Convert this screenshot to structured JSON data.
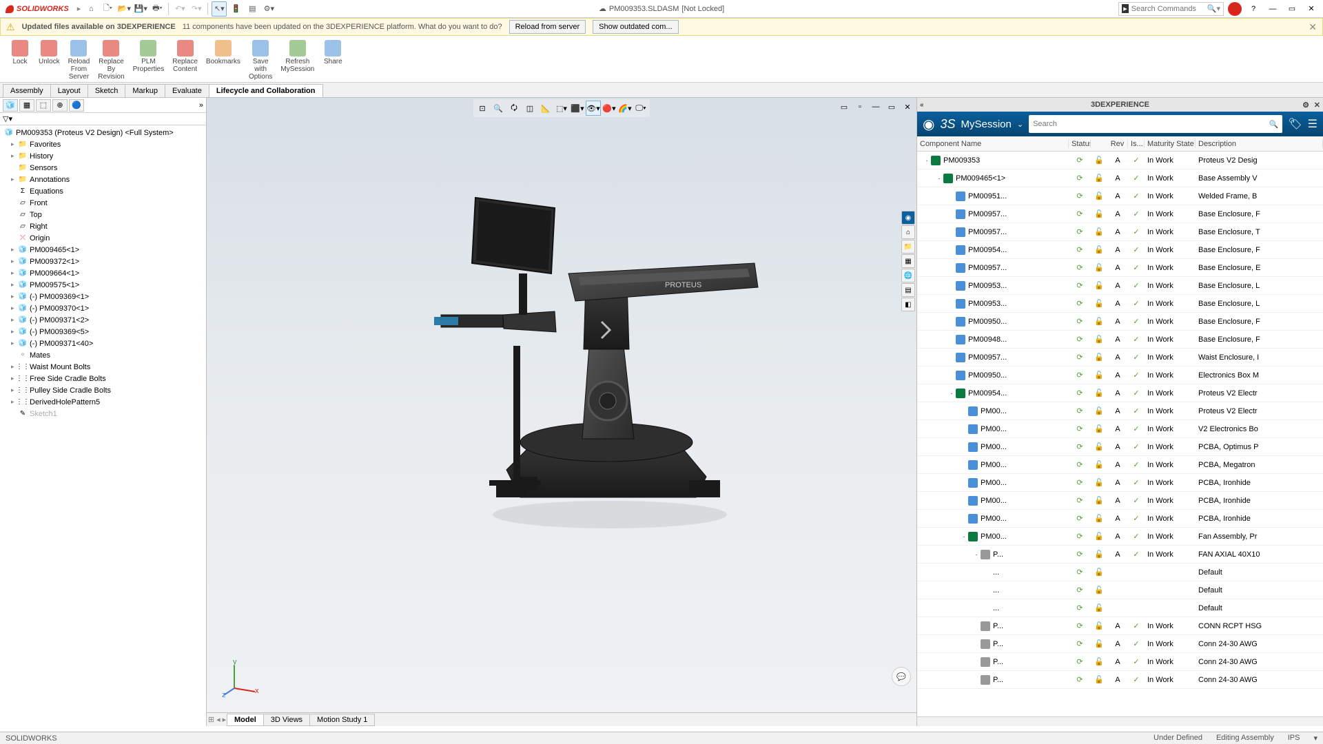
{
  "app": {
    "name": "SOLIDWORKS"
  },
  "document": {
    "filename": "PM009353.SLDASM",
    "lock_state": "[Not Locked]"
  },
  "search_commands": {
    "placeholder": "Search Commands"
  },
  "notification": {
    "bold": "Updated files available on 3DEXPERIENCE",
    "msg": "11 components have been updated on the 3DEXPERIENCE platform. What do you want to do?",
    "btn_reload": "Reload from server",
    "btn_show": "Show outdated com..."
  },
  "ribbon": [
    {
      "label": "Lock"
    },
    {
      "label": "Unlock"
    },
    {
      "label": "Reload\nFrom\nServer"
    },
    {
      "label": "Replace\nBy\nRevision"
    },
    {
      "label": "PLM\nProperties"
    },
    {
      "label": "Replace\nContent"
    },
    {
      "label": "Bookmarks"
    },
    {
      "label": "Save\nwith\nOptions"
    },
    {
      "label": "Refresh\nMySession"
    },
    {
      "label": "Share"
    }
  ],
  "tabs": [
    "Assembly",
    "Layout",
    "Sketch",
    "Markup",
    "Evaluate",
    "Lifecycle and Collaboration"
  ],
  "active_tab": 5,
  "feature_tree": {
    "root": "PM009353 (Proteus V2 Design) <Full System>",
    "nodes": [
      {
        "label": "Favorites",
        "ico": "folder",
        "arrow": true
      },
      {
        "label": "History",
        "ico": "folder",
        "arrow": true
      },
      {
        "label": "Sensors",
        "ico": "folder",
        "arrow": false
      },
      {
        "label": "Annotations",
        "ico": "folder",
        "arrow": true
      },
      {
        "label": "Equations",
        "ico": "eq",
        "arrow": false
      },
      {
        "label": "Front",
        "ico": "plane",
        "arrow": false
      },
      {
        "label": "Top",
        "ico": "plane",
        "arrow": false
      },
      {
        "label": "Right",
        "ico": "plane",
        "arrow": false
      },
      {
        "label": "Origin",
        "ico": "origin",
        "arrow": false
      },
      {
        "label": "PM009465<1>",
        "ico": "asm",
        "arrow": true
      },
      {
        "label": "PM009372<1>",
        "ico": "asm",
        "arrow": true
      },
      {
        "label": "PM009664<1>",
        "ico": "asm",
        "arrow": true
      },
      {
        "label": "PM009575<1>",
        "ico": "asm",
        "arrow": true
      },
      {
        "label": "(-) PM009369<1>",
        "ico": "asm",
        "arrow": true
      },
      {
        "label": "(-) PM009370<1>",
        "ico": "asm",
        "arrow": true
      },
      {
        "label": "(-) PM009371<2>",
        "ico": "asm",
        "arrow": true
      },
      {
        "label": "(-) PM009369<5>",
        "ico": "asm",
        "arrow": true
      },
      {
        "label": "(-) PM009371<40>",
        "ico": "asm",
        "arrow": true
      },
      {
        "label": "Mates",
        "ico": "mate",
        "arrow": false
      },
      {
        "label": "Waist Mount Bolts",
        "ico": "pattern",
        "arrow": true
      },
      {
        "label": "Free Side Cradle Bolts",
        "ico": "pattern",
        "arrow": true
      },
      {
        "label": "Pulley Side Cradle Bolts",
        "ico": "pattern",
        "arrow": true
      },
      {
        "label": "DerivedHolePattern5",
        "ico": "pattern",
        "arrow": true
      },
      {
        "label": "Sketch1",
        "ico": "sketch",
        "arrow": false,
        "gray": true
      }
    ]
  },
  "bottom_tabs": [
    "Model",
    "3D Views",
    "Motion Study 1"
  ],
  "active_bottom_tab": 0,
  "threedx": {
    "title": "3DEXPERIENCE",
    "session": "MySession",
    "search_placeholder": "Search",
    "columns": [
      "Component Name",
      "Status",
      "",
      "Rev",
      "Is...",
      "Maturity State",
      "Description"
    ],
    "rows": [
      {
        "indent": 0,
        "exp": "-",
        "ico": "asm",
        "name": "PM009353",
        "rev": "A",
        "mat": "In Work",
        "desc": "Proteus V2 Desig"
      },
      {
        "indent": 1,
        "exp": "-",
        "ico": "asm",
        "name": "PM009465<1>",
        "rev": "A",
        "mat": "In Work",
        "desc": "Base Assembly V"
      },
      {
        "indent": 2,
        "exp": "",
        "ico": "part",
        "name": "PM00951...",
        "rev": "A",
        "mat": "In Work",
        "desc": "Welded Frame, B"
      },
      {
        "indent": 2,
        "exp": "",
        "ico": "part",
        "name": "PM00957...",
        "rev": "A",
        "mat": "In Work",
        "desc": "Base Enclosure, F"
      },
      {
        "indent": 2,
        "exp": "",
        "ico": "part",
        "name": "PM00957...",
        "rev": "A",
        "mat": "In Work",
        "desc": "Base Enclosure, T"
      },
      {
        "indent": 2,
        "exp": "",
        "ico": "part",
        "name": "PM00954...",
        "rev": "A",
        "mat": "In Work",
        "desc": "Base Enclosure, F"
      },
      {
        "indent": 2,
        "exp": "",
        "ico": "part",
        "name": "PM00957...",
        "rev": "A",
        "mat": "In Work",
        "desc": "Base Enclosure, E"
      },
      {
        "indent": 2,
        "exp": "",
        "ico": "part",
        "name": "PM00953...",
        "rev": "A",
        "mat": "In Work",
        "desc": "Base Enclosure, L"
      },
      {
        "indent": 2,
        "exp": "",
        "ico": "part",
        "name": "PM00953...",
        "rev": "A",
        "mat": "In Work",
        "desc": "Base Enclosure, L"
      },
      {
        "indent": 2,
        "exp": "",
        "ico": "part",
        "name": "PM00950...",
        "rev": "A",
        "mat": "In Work",
        "desc": "Base Enclosure, F"
      },
      {
        "indent": 2,
        "exp": "",
        "ico": "part",
        "name": "PM00948...",
        "rev": "A",
        "mat": "In Work",
        "desc": "Base Enclosure, F"
      },
      {
        "indent": 2,
        "exp": "",
        "ico": "part",
        "name": "PM00957...",
        "rev": "A",
        "mat": "In Work",
        "desc": "Waist Enclosure, I"
      },
      {
        "indent": 2,
        "exp": "",
        "ico": "part",
        "name": "PM00950...",
        "rev": "A",
        "mat": "In Work",
        "desc": "Electronics Box M"
      },
      {
        "indent": 2,
        "exp": "-",
        "ico": "asm",
        "name": "PM00954...",
        "rev": "A",
        "mat": "In Work",
        "desc": "Proteus V2 Electr"
      },
      {
        "indent": 3,
        "exp": "",
        "ico": "part",
        "name": "PM00...",
        "rev": "A",
        "mat": "In Work",
        "desc": "Proteus V2 Electr"
      },
      {
        "indent": 3,
        "exp": "",
        "ico": "part",
        "name": "PM00...",
        "rev": "A",
        "mat": "In Work",
        "desc": "V2 Electronics Bo"
      },
      {
        "indent": 3,
        "exp": "",
        "ico": "part",
        "name": "PM00...",
        "rev": "A",
        "mat": "In Work",
        "desc": "PCBA, Optimus P"
      },
      {
        "indent": 3,
        "exp": "",
        "ico": "part",
        "name": "PM00...",
        "rev": "A",
        "mat": "In Work",
        "desc": "PCBA, Megatron"
      },
      {
        "indent": 3,
        "exp": "",
        "ico": "part",
        "name": "PM00...",
        "rev": "A",
        "mat": "In Work",
        "desc": "PCBA, Ironhide"
      },
      {
        "indent": 3,
        "exp": "",
        "ico": "part",
        "name": "PM00...",
        "rev": "A",
        "mat": "In Work",
        "desc": "PCBA, Ironhide"
      },
      {
        "indent": 3,
        "exp": "",
        "ico": "part",
        "name": "PM00...",
        "rev": "A",
        "mat": "In Work",
        "desc": "PCBA, Ironhide"
      },
      {
        "indent": 3,
        "exp": "-",
        "ico": "asm",
        "name": "PM00...",
        "rev": "A",
        "mat": "In Work",
        "desc": "Fan Assembly, Pr"
      },
      {
        "indent": 4,
        "exp": "-",
        "ico": "gray",
        "name": "P...",
        "rev": "A",
        "mat": "In Work",
        "desc": "FAN AXIAL 40X10"
      },
      {
        "indent": 5,
        "exp": "",
        "ico": "",
        "name": "...",
        "rev": "",
        "mat": "",
        "desc": "Default"
      },
      {
        "indent": 5,
        "exp": "",
        "ico": "",
        "name": "...",
        "rev": "",
        "mat": "",
        "desc": "Default"
      },
      {
        "indent": 5,
        "exp": "",
        "ico": "",
        "name": "...",
        "rev": "",
        "mat": "",
        "desc": "Default"
      },
      {
        "indent": 4,
        "exp": "",
        "ico": "gray",
        "name": "P...",
        "rev": "A",
        "mat": "In Work",
        "desc": "CONN RCPT HSG"
      },
      {
        "indent": 4,
        "exp": "",
        "ico": "gray",
        "name": "P...",
        "rev": "A",
        "mat": "In Work",
        "desc": "Conn 24-30 AWG"
      },
      {
        "indent": 4,
        "exp": "",
        "ico": "gray",
        "name": "P...",
        "rev": "A",
        "mat": "In Work",
        "desc": "Conn 24-30 AWG"
      },
      {
        "indent": 4,
        "exp": "",
        "ico": "gray",
        "name": "P...",
        "rev": "A",
        "mat": "In Work",
        "desc": "Conn 24-30 AWG"
      }
    ]
  },
  "status": {
    "app": "SOLIDWORKS",
    "left": "",
    "under": "Under Defined",
    "mode": "Editing Assembly",
    "units": "IPS"
  }
}
